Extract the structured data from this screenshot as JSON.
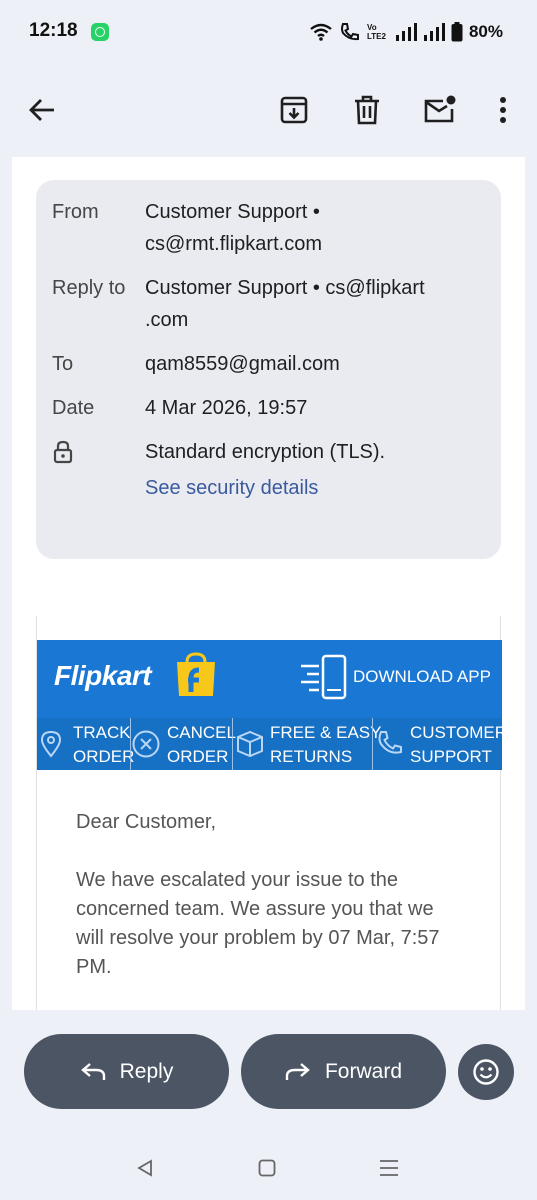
{
  "status": {
    "time": "12:18",
    "battery": "80%",
    "volte_label": "Vo LTE2"
  },
  "toolbar": {
    "back_icon": "arrow-left-icon",
    "archive_icon": "archive-icon",
    "delete_icon": "trash-icon",
    "mark_unread_icon": "mail-unread-icon",
    "more_icon": "more-vertical-icon"
  },
  "details": {
    "from_label": "From",
    "from_value_line1": "Customer Support •",
    "from_value_line2": "cs@rmt.flipkart.com",
    "reply_to_label": "Reply to",
    "reply_to_line1": "Customer Support • cs@flipkart",
    "reply_to_line2": ".com",
    "to_label": "To",
    "to_value": "qam8559@gmail.com",
    "date_label": "Date",
    "date_value": "4 Mar 2026, 19:57",
    "encryption_text": "Standard encryption (TLS).",
    "security_link": "See security details"
  },
  "email": {
    "brand": "Flipkart",
    "download_app": "DOWNLOAD APP",
    "nav": [
      {
        "line1": "TRACK",
        "line2": "ORDER"
      },
      {
        "line1": "CANCEL",
        "line2": "ORDER"
      },
      {
        "line1": "FREE & EASY",
        "line2": "RETURNS"
      },
      {
        "line1": "CUSTOMER",
        "line2": "SUPPORT"
      }
    ],
    "greeting": "Dear Customer,",
    "body_line1": "We have escalated your issue to the",
    "body_line2": "concerned team. We assure you that we",
    "body_line3": "will resolve your problem by 07 Mar, 7:57",
    "body_line4": "PM.",
    "colors": {
      "banner": "#1a78d4",
      "nav": "#1670c4",
      "bag": "#f7c719"
    }
  },
  "actions": {
    "reply": "Reply",
    "forward": "Forward",
    "emoji_icon": "smiley-icon"
  }
}
